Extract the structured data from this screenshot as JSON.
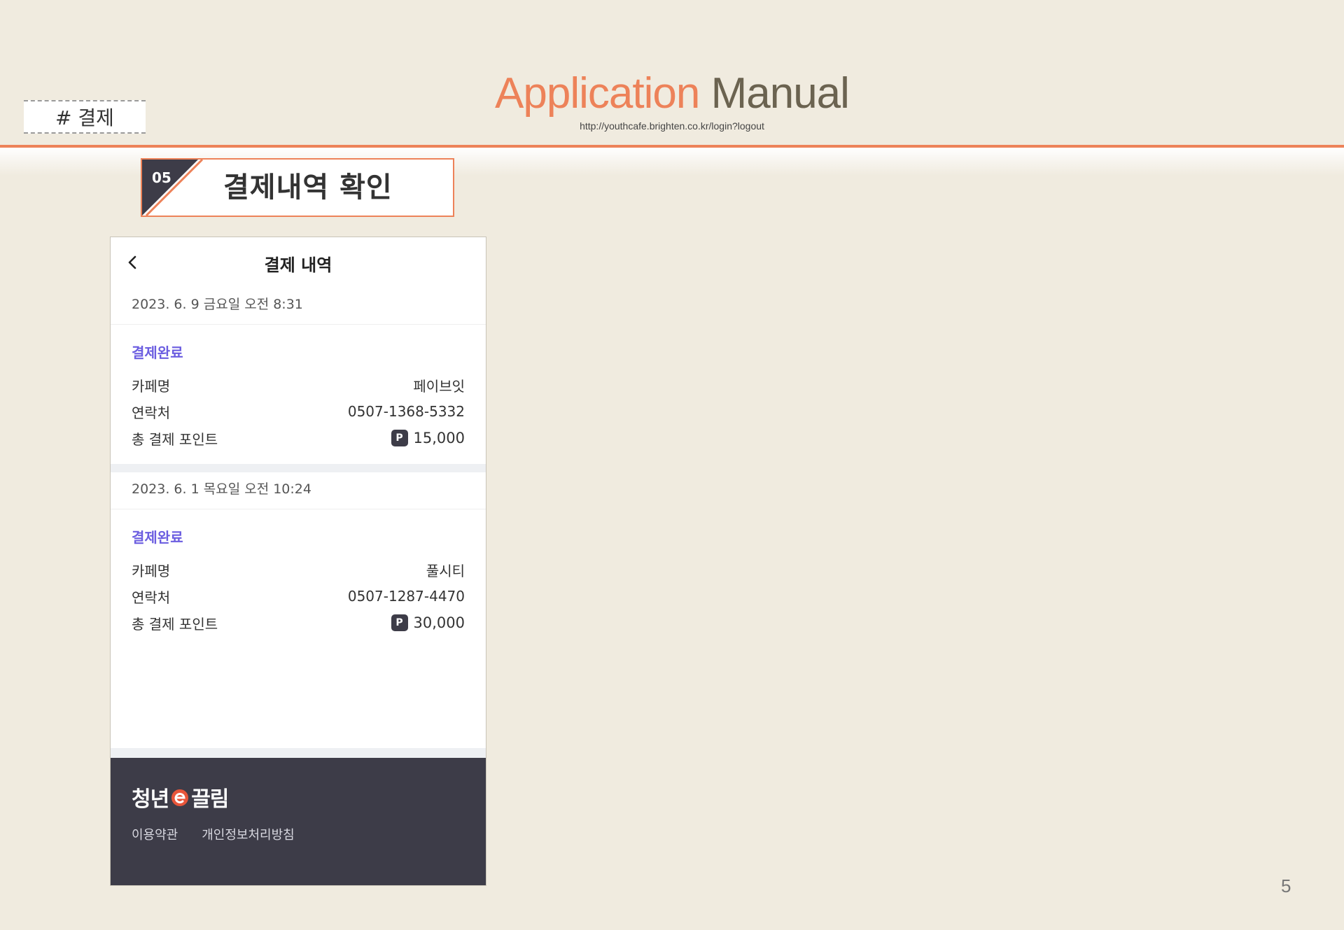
{
  "section_tag": "# 결제",
  "header": {
    "title_part1": "Application",
    "title_part2": "Manual",
    "url": "http://youthcafe.brighten.co.kr/login?logout"
  },
  "step": {
    "number": "05",
    "title": "결제내역 확인"
  },
  "phone": {
    "title": "결제 내역",
    "back_icon": "chevron-left-icon",
    "payments": [
      {
        "date": "2023. 6. 9 금요일   오전 8:31",
        "status": "결제완료",
        "cafe_label": "카페명",
        "cafe_value": "페이브잇",
        "contact_label": "연락처",
        "contact_value": "0507-1368-5332",
        "points_label": "총 결제 포인트",
        "points_badge": "P",
        "points_value": "15,000"
      },
      {
        "date": "2023. 6. 1  목요일   오전 10:24",
        "status": "결제완료",
        "cafe_label": "카페명",
        "cafe_value": "풀시티",
        "contact_label": "연락처",
        "contact_value": "0507-1287-4470",
        "points_label": "총 결제 포인트",
        "points_badge": "P",
        "points_value": "30,000"
      }
    ],
    "footer": {
      "logo_left": "청년",
      "logo_right": "끌림",
      "links": [
        "이용약관",
        "개인정보처리방침"
      ]
    }
  },
  "page_number": "5",
  "colors": {
    "accent": "#ed8259",
    "status": "#6b5de0",
    "footer": "#3d3c48",
    "background": "#f0ebdf"
  }
}
